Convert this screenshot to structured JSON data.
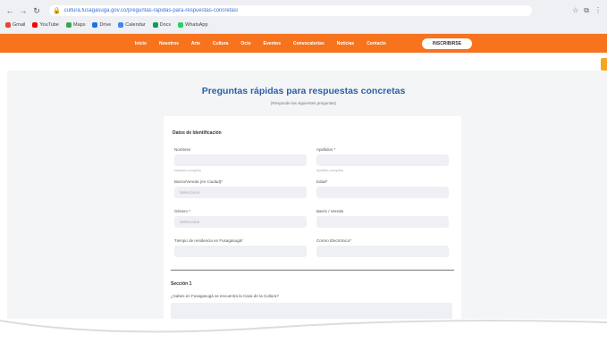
{
  "browser": {
    "nav_icons": [
      "back-icon",
      "forward-icon",
      "reload-icon"
    ],
    "url": "cultura.fusagasuga.gov.co/preguntas-rapidas-para-respuestas-concretas/",
    "right_icons": [
      "star-icon",
      "extensions-icon",
      "menu-icon"
    ],
    "bookmarks": [
      {
        "label": "Gmail",
        "color": "#ea4335"
      },
      {
        "label": "YouTube",
        "color": "#ff0000"
      },
      {
        "label": "Maps",
        "color": "#34a853"
      },
      {
        "label": "Drive",
        "color": "#1a73e8"
      },
      {
        "label": "Calendar",
        "color": "#4285f4"
      },
      {
        "label": "Docs",
        "color": "#0f9d58"
      },
      {
        "label": "WhatsApp",
        "color": "#25d366"
      }
    ]
  },
  "site_nav": {
    "items": [
      "Inicio",
      "Nosotros",
      "Arte",
      "Cultura",
      "Ocio",
      "Eventos",
      "Convocatorias",
      "Noticias",
      "Contacto"
    ],
    "cta": "INSCRIBIRSE",
    "color": "#f7731d"
  },
  "page": {
    "title": "Preguntas rápidas para respuestas concretas",
    "subtitle": "(Responde las siguientes preguntas)"
  },
  "form": {
    "section_identification": "Datos de Identificación",
    "fields": {
      "nombres": {
        "label": "Nombres",
        "hint": "Nombre completo"
      },
      "apellidos": {
        "label": "Apellidos *",
        "hint": "Apellido completo"
      },
      "barrio": {
        "label": "Barrio/Vereda (en Ciudad)*",
        "placeholder": "Selecciona"
      },
      "edad": {
        "label": "Edad*",
        "placeholder": ""
      },
      "genero": {
        "label": "Género *",
        "placeholder": "Selecciona"
      },
      "barrio_vereda": {
        "label": "Barrio / Vereda",
        "placeholder": ""
      },
      "tiempo": {
        "label": "Tiempo de residencia en Fusagasugá*",
        "placeholder": ""
      },
      "correo": {
        "label": "Correo Electrónico*",
        "placeholder": ""
      }
    },
    "section_1": "Sección 1",
    "question_1": "¿Sabes en Fusagasugá se encuentra la Casa de la Cultura?"
  }
}
